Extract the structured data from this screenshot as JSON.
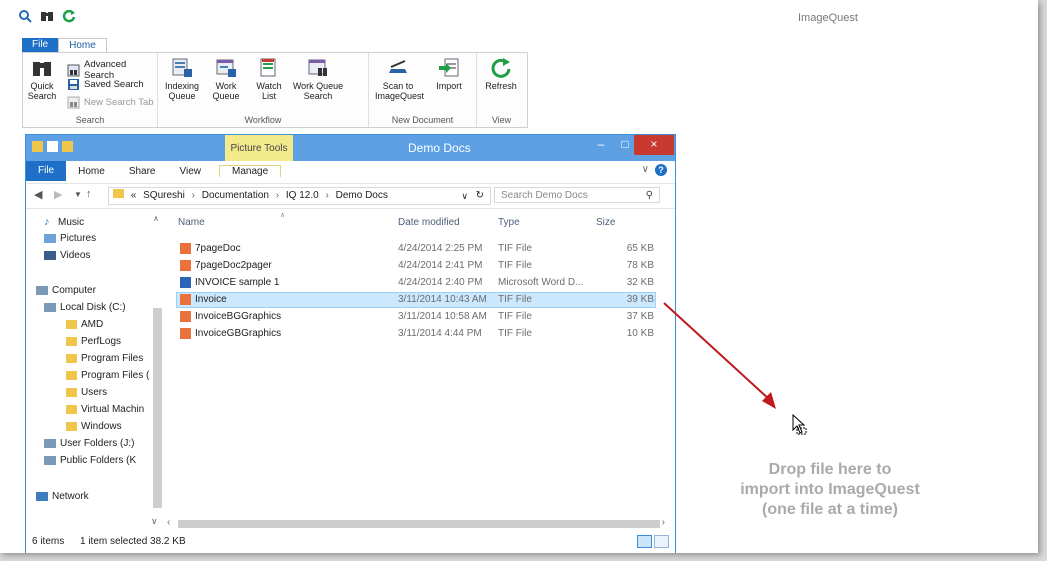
{
  "app": {
    "title": "ImageQuest",
    "tabs": [
      "File",
      "Home"
    ]
  },
  "ribbon": {
    "groups": {
      "search": {
        "label": "Search",
        "quick_search": "Quick Search",
        "advanced_search": "Advanced Search",
        "saved_search": "Saved Search",
        "new_search_tab": "New Search Tab"
      },
      "workflow": {
        "label": "Workflow",
        "indexing_queue": "Indexing Queue",
        "work_queue": "Work Queue",
        "watch_list": "Watch List",
        "work_queue_search": "Work Queue Search"
      },
      "new_document": {
        "label": "New Document",
        "scan": "Scan to ImageQuest",
        "import": "Import"
      },
      "view": {
        "label": "View",
        "refresh": "Refresh"
      }
    }
  },
  "explorer": {
    "title": "Demo Docs",
    "contextual_tab_group": "Picture Tools",
    "tabs": [
      "File",
      "Home",
      "Share",
      "View",
      "Manage"
    ],
    "breadcrumb": [
      "«",
      "SQureshi",
      "Documentation",
      "IQ 12.0",
      "Demo Docs"
    ],
    "search_placeholder": "Search Demo Docs",
    "nav": {
      "music": "Music",
      "pictures": "Pictures",
      "videos": "Videos",
      "computer": "Computer",
      "local_disk": "Local Disk (C:)",
      "amd": "AMD",
      "perflogs": "PerfLogs",
      "program_files": "Program Files",
      "program_files_x86": "Program Files (",
      "users": "Users",
      "virtual_machines": "Virtual Machin",
      "windows": "Windows",
      "user_folders": "User Folders (J:)",
      "public_folders": "Public Folders (K",
      "network": "Network"
    },
    "columns": {
      "name": "Name",
      "date": "Date modified",
      "type": "Type",
      "size": "Size"
    },
    "files": [
      {
        "name": "7pageDoc",
        "date": "4/24/2014 2:25 PM",
        "type": "TIF File",
        "size": "65 KB"
      },
      {
        "name": "7pageDoc2pager",
        "date": "4/24/2014 2:41 PM",
        "type": "TIF File",
        "size": "78 KB"
      },
      {
        "name": "INVOICE sample 1",
        "date": "4/24/2014 2:40 PM",
        "type": "Microsoft Word D...",
        "size": "32 KB"
      },
      {
        "name": "Invoice",
        "date": "3/11/2014 10:43 AM",
        "type": "TIF File",
        "size": "39 KB"
      },
      {
        "name": "InvoiceBGGraphics",
        "date": "3/11/2014 10:58 AM",
        "type": "TIF File",
        "size": "37 KB"
      },
      {
        "name": "InvoiceGBGraphics",
        "date": "3/11/2014 4:44 PM",
        "type": "TIF File",
        "size": "10 KB"
      }
    ],
    "status": {
      "items": "6 items",
      "selected": "1 item selected  38.2 KB"
    }
  },
  "drop_zone": {
    "line1": "Drop file here to",
    "line2": "import into ImageQuest",
    "line3": "(one file at a time)"
  },
  "colors": {
    "accent": "#1e6fc8",
    "explorer_title": "#5da0e4",
    "close": "#c8392f",
    "arrow": "#c0181c",
    "drop_text": "#aaaaaa"
  }
}
